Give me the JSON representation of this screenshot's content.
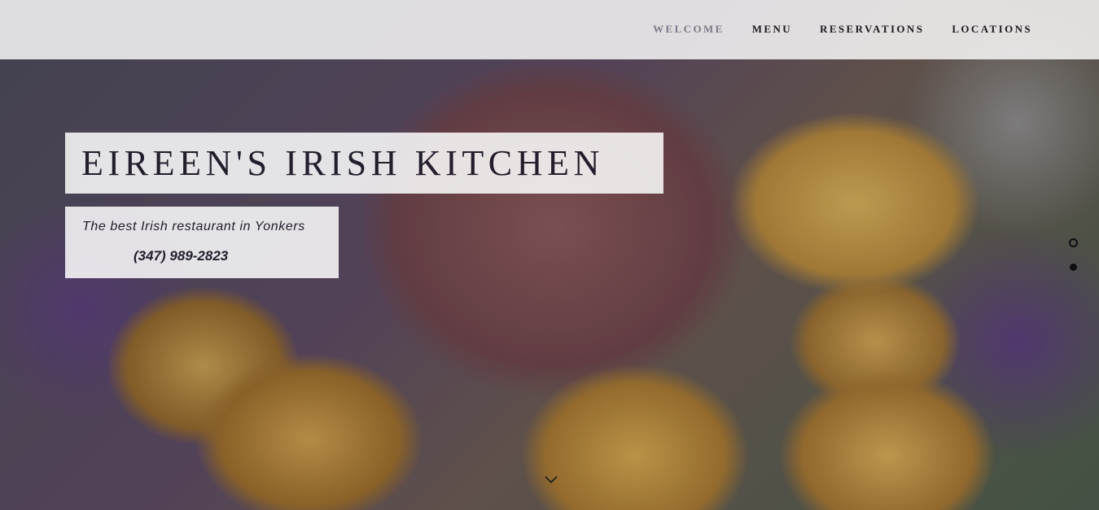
{
  "nav": {
    "items": [
      {
        "label": "WELCOME",
        "active": true
      },
      {
        "label": "MENU",
        "active": false
      },
      {
        "label": "RESERVATIONS",
        "active": false
      },
      {
        "label": "LOCATIONS",
        "active": false
      }
    ]
  },
  "hero": {
    "title": "EIREEN'S IRISH KITCHEN",
    "tagline": "The best Irish restaurant in Yonkers",
    "phone": "(347) 989-2823",
    "background_image": "corned-beef-cabbage-potatoes-photo"
  },
  "slider": {
    "slide_count": 2,
    "active_slide": 2
  },
  "colors": {
    "text_dark": "#231d2c",
    "nav_active": "#7f7888"
  }
}
